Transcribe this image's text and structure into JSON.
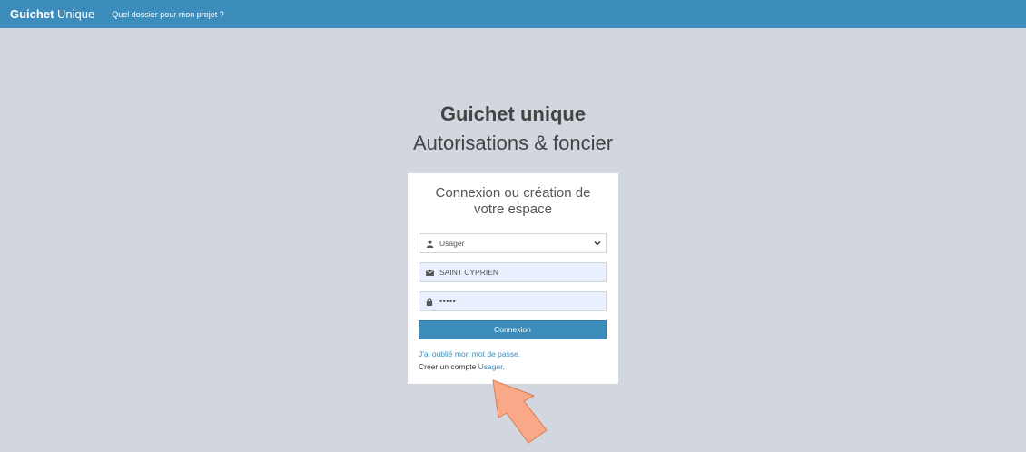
{
  "header": {
    "brand_bold": "Guichet",
    "brand_light": " Unique",
    "nav_link": "Quel dossier pour mon projet ?"
  },
  "page": {
    "title": "Guichet unique",
    "subtitle": "Autorisations & foncier"
  },
  "login": {
    "message": "Connexion ou création de votre espace",
    "profile_select": {
      "selected": "Usager",
      "icon": "user-icon"
    },
    "email": {
      "value": "SAINT CYPRIEN",
      "icon": "envelope-icon"
    },
    "password": {
      "value": "•••••",
      "icon": "lock-icon"
    },
    "submit_label": "Connexion",
    "forgot_link": "J'ai oublié mon mot de passe.",
    "create_prefix": "Créer un compte ",
    "create_link": "Usager",
    "create_suffix": "."
  },
  "colors": {
    "primary": "#3c8dbc",
    "background": "#d2d6de",
    "autofill": "#e8f0fe",
    "arrow": "#f9a987"
  }
}
